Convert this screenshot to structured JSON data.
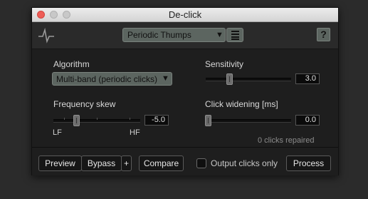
{
  "window": {
    "title": "De-click"
  },
  "header": {
    "preset": {
      "value": "Periodic Thumps",
      "arrow": "▼"
    },
    "help_label": "?"
  },
  "controls": {
    "algorithm": {
      "label": "Algorithm",
      "value": "Multi-band (periodic clicks)",
      "arrow": "▼"
    },
    "sensitivity": {
      "label": "Sensitivity",
      "value": "3.0",
      "level": 0.3
    },
    "frequency_skew": {
      "label": "Frequency skew",
      "value": "-5.0",
      "left_label": "LF",
      "right_label": "HF"
    },
    "click_widening": {
      "label": "Click widening [ms]",
      "value": "0.0"
    }
  },
  "status": {
    "clicks_repaired": "0 clicks repaired"
  },
  "footer": {
    "preview_label": "Preview",
    "bypass_label": "Bypass",
    "plus_label": "+",
    "compare_label": "Compare",
    "output_clicks_only_label": "Output clicks only",
    "output_clicks_only_checked": false,
    "process_label": "Process"
  },
  "colors": {
    "control_bg": "#5c6560",
    "window_bg": "#1e1e1e",
    "close": "#ee5d57"
  }
}
